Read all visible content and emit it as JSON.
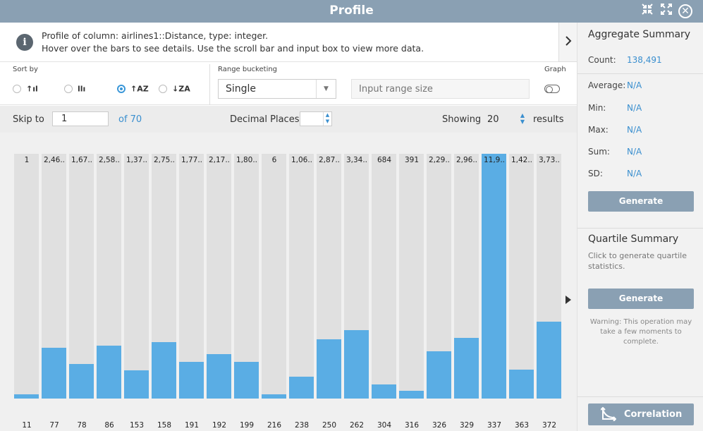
{
  "window": {
    "title": "Profile"
  },
  "info": {
    "line1": "Profile of column: airlines1::Distance, type: integer.",
    "line2": "Hover over the bars to see details. Use the scroll bar and input box to view more data."
  },
  "sort": {
    "label": "Sort by",
    "options": [
      {
        "glyph": "↑ıl",
        "selected": false
      },
      {
        "glyph": "llı",
        "selected": false
      },
      {
        "glyph": "↑AZ",
        "selected": true
      },
      {
        "glyph": "↓ZA",
        "selected": false
      }
    ]
  },
  "range": {
    "label": "Range bucketing",
    "select_value": "Single",
    "input_placeholder": "Input range size"
  },
  "graph": {
    "label": "Graph",
    "enabled": false
  },
  "skip": {
    "label": "Skip to",
    "value": "1",
    "of_label": "of 70"
  },
  "decimal": {
    "label": "Decimal Places",
    "value": ""
  },
  "showing": {
    "label": "Showing",
    "value": "20",
    "suffix": "results"
  },
  "chart_data": {
    "type": "bar",
    "categories": [
      "11",
      "77",
      "78",
      "86",
      "153",
      "158",
      "191",
      "192",
      "199",
      "216",
      "238",
      "250",
      "262",
      "304",
      "316",
      "326",
      "329",
      "337",
      "363",
      "372"
    ],
    "value_labels": [
      "1",
      "2,46..",
      "1,67..",
      "2,58..",
      "1,37..",
      "2,75..",
      "1,77..",
      "2,17..",
      "1,80..",
      "6",
      "1,06..",
      "2,87..",
      "3,34..",
      "684",
      "391",
      "2,29..",
      "2,96..",
      "11,9..",
      "1,42..",
      "3,73.."
    ],
    "values": [
      1,
      2460,
      1670,
      2580,
      1370,
      2750,
      1770,
      2170,
      1800,
      6,
      1060,
      2870,
      3340,
      684,
      391,
      2290,
      2960,
      11900,
      1420,
      3730
    ],
    "colors": {
      "fill": "#5aade4",
      "track": "#e0e0e0"
    }
  },
  "aggregate": {
    "title": "Aggregate Summary",
    "count_label": "Count:",
    "count_value": "138,491",
    "stats": [
      {
        "label": "Average:",
        "value": "N/A"
      },
      {
        "label": "Min:",
        "value": "N/A"
      },
      {
        "label": "Max:",
        "value": "N/A"
      },
      {
        "label": "Sum:",
        "value": "N/A"
      },
      {
        "label": "SD:",
        "value": "N/A"
      }
    ],
    "button": "Generate"
  },
  "quartile": {
    "title": "Quartile Summary",
    "description": "Click to generate quartile statistics.",
    "button": "Generate",
    "warning": "Warning: This operation may take a few moments to complete."
  },
  "correlation": {
    "button": "Correlation"
  }
}
